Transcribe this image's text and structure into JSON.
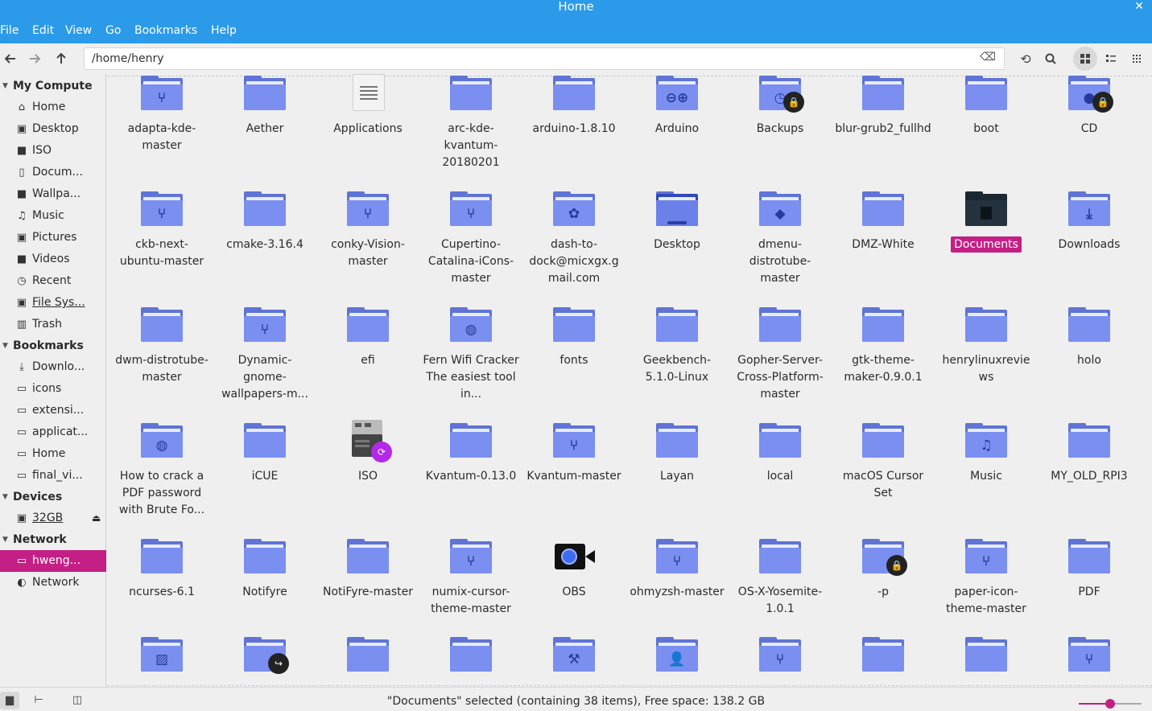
{
  "window": {
    "title": "Home",
    "close_glyph": "✕"
  },
  "menu": [
    "File",
    "Edit",
    "View",
    "Go",
    "Bookmarks",
    "Help"
  ],
  "toolbar": {
    "path": "/home/henry",
    "back_icon": "arrow-left-icon",
    "forward_icon": "arrow-right-icon",
    "up_icon": "arrow-up-icon",
    "clear_icon": "backspace-icon",
    "refresh_icon": "reload-icon",
    "search_icon": "search-icon",
    "view_icons": "grid-icon",
    "view_list": "list-icon",
    "view_compact": "compact-icon"
  },
  "sidebar": {
    "sections": [
      {
        "title": "My Compute",
        "items": [
          {
            "label": "Home",
            "icon": "⌂"
          },
          {
            "label": "Desktop",
            "icon": "▣"
          },
          {
            "label": "ISO",
            "icon": "■"
          },
          {
            "label": "Docum...",
            "icon": "▯"
          },
          {
            "label": "Wallpa...",
            "icon": "■"
          },
          {
            "label": "Music",
            "icon": "♫"
          },
          {
            "label": "Pictures",
            "icon": "▣"
          },
          {
            "label": "Videos",
            "icon": "■"
          },
          {
            "label": "Recent",
            "icon": "◷"
          },
          {
            "label": "File Sys...",
            "icon": "▣"
          },
          {
            "label": "Trash",
            "icon": "▥"
          }
        ]
      },
      {
        "title": "Bookmarks",
        "items": [
          {
            "label": "Downlo...",
            "icon": "⤓"
          },
          {
            "label": "icons",
            "icon": "▭"
          },
          {
            "label": "extensi...",
            "icon": "▭"
          },
          {
            "label": "applicat...",
            "icon": "▭"
          },
          {
            "label": "Home",
            "icon": "▭"
          },
          {
            "label": "final_vi...",
            "icon": "▭"
          }
        ]
      },
      {
        "title": "Devices",
        "items": [
          {
            "label": "32GB",
            "icon": "▣"
          }
        ]
      },
      {
        "title": "Network",
        "items": [
          {
            "label": "hweng...",
            "icon": "▭"
          },
          {
            "label": "Network",
            "icon": "◐"
          }
        ]
      }
    ]
  },
  "files": [
    {
      "name": "adapta-kde-master",
      "emb": "⑂"
    },
    {
      "name": "Aether",
      "emb": ""
    },
    {
      "name": "Applications",
      "kind": "apps"
    },
    {
      "name": "arc-kde-kvantum-20180201",
      "emb": ""
    },
    {
      "name": "arduino-1.8.10",
      "emb": ""
    },
    {
      "name": "Arduino",
      "emb": "⊖⊕"
    },
    {
      "name": "Backups",
      "emb": "◷",
      "badge": "🔒"
    },
    {
      "name": "blur-grub2_fullhd",
      "emb": ""
    },
    {
      "name": "boot",
      "emb": ""
    },
    {
      "name": "CD",
      "emb": "●",
      "badge": "🔒"
    },
    {
      "name": "ckb-next-ubuntu-master",
      "emb": "⑂"
    },
    {
      "name": "cmake-3.16.4",
      "emb": ""
    },
    {
      "name": "conky-Vision-master",
      "emb": "⑂"
    },
    {
      "name": "Cupertino-Catalina-iCons-master",
      "emb": "⑂"
    },
    {
      "name": "dash-to-dock@micxgx.gmail.com",
      "emb": "✿"
    },
    {
      "name": "Desktop",
      "kind": "desktop"
    },
    {
      "name": "dmenu-distrotube-master",
      "emb": "◆"
    },
    {
      "name": "DMZ-White",
      "emb": ""
    },
    {
      "name": "Documents",
      "kind": "docdark",
      "selected": true
    },
    {
      "name": "Downloads",
      "emb": "⤓"
    },
    {
      "name": "dwm-distrotube-master",
      "emb": ""
    },
    {
      "name": "Dynamic-gnome-wallpapers-m...",
      "emb": "⑂"
    },
    {
      "name": "efi",
      "emb": ""
    },
    {
      "name": "Fern Wifi Cracker The easiest tool in...",
      "emb": "◍"
    },
    {
      "name": "fonts",
      "emb": ""
    },
    {
      "name": "Geekbench-5.1.0-Linux",
      "emb": ""
    },
    {
      "name": "Gopher-Server-Cross-Platform-master",
      "emb": ""
    },
    {
      "name": "gtk-theme-maker-0.9.0.1",
      "emb": ""
    },
    {
      "name": "henrylinuxreviews",
      "emb": ""
    },
    {
      "name": "holo",
      "emb": ""
    },
    {
      "name": "How to crack a PDF password with Brute Fo...",
      "emb": "◍"
    },
    {
      "name": "iCUE",
      "emb": ""
    },
    {
      "name": "ISO",
      "kind": "iso"
    },
    {
      "name": "Kvantum-0.13.0",
      "emb": ""
    },
    {
      "name": "Kvantum-master",
      "emb": "⑂"
    },
    {
      "name": "Layan",
      "emb": ""
    },
    {
      "name": "local",
      "emb": ""
    },
    {
      "name": "macOS Cursor Set",
      "emb": ""
    },
    {
      "name": "Music",
      "emb": "♫"
    },
    {
      "name": "MY_OLD_RPI3",
      "emb": ""
    },
    {
      "name": "ncurses-6.1",
      "emb": ""
    },
    {
      "name": "Notifyre",
      "emb": ""
    },
    {
      "name": "NotiFyre-master",
      "emb": ""
    },
    {
      "name": "numix-cursor-theme-master",
      "emb": "⑂"
    },
    {
      "name": "OBS",
      "kind": "obs"
    },
    {
      "name": "ohmyzsh-master",
      "emb": "⑂"
    },
    {
      "name": "OS-X-Yosemite-1.0.1",
      "emb": ""
    },
    {
      "name": "-p",
      "emb": "",
      "badge": "🔒"
    },
    {
      "name": "paper-icon-theme-master",
      "emb": "⑂"
    },
    {
      "name": "PDF",
      "emb": ""
    },
    {
      "name": "",
      "emb": "▨"
    },
    {
      "name": "",
      "emb": "",
      "badge": "↪"
    },
    {
      "name": "",
      "emb": ""
    },
    {
      "name": "",
      "emb": ""
    },
    {
      "name": "",
      "emb": "⚒"
    },
    {
      "name": "",
      "emb": "👤"
    },
    {
      "name": "",
      "emb": "⑂"
    },
    {
      "name": "",
      "emb": ""
    },
    {
      "name": "",
      "emb": ""
    },
    {
      "name": "",
      "emb": "⑂"
    }
  ],
  "status": {
    "text": "\"Documents\" selected (containing 38 items), Free space: 138.2 GB",
    "zoom_level": 0.5
  },
  "colors": {
    "accent": "#c41f85",
    "titlebar": "#2b9ae8",
    "folder": "#7a8ff0"
  }
}
